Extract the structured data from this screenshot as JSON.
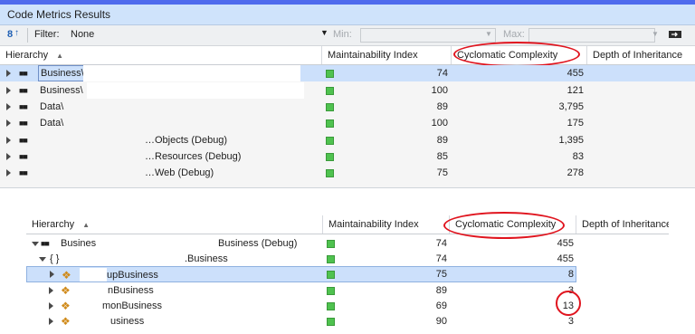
{
  "panel1": {
    "title": "Code Metrics Results",
    "toolbar": {
      "filter_label": "Filter:",
      "filter_value": "None",
      "min_label": "Min:",
      "max_label": "Max:"
    },
    "columns": [
      "Hierarchy",
      "Maintainability Index",
      "Cyclomatic Complexity",
      "Depth of Inheritance"
    ],
    "rows": [
      {
        "name": "Business\\",
        "mi": "74",
        "cc": "455"
      },
      {
        "name": "Business\\",
        "mi": "100",
        "cc": "121"
      },
      {
        "name": "Data\\",
        "mi": "89",
        "cc": "3,795"
      },
      {
        "name": "Data\\",
        "mi": "100",
        "cc": "175"
      },
      {
        "name": "…Objects (Debug)",
        "mi": "89",
        "cc": "1,395"
      },
      {
        "name": "…Resources (Debug)",
        "mi": "85",
        "cc": "83"
      },
      {
        "name": "…Web (Debug)",
        "mi": "75",
        "cc": "278"
      }
    ]
  },
  "panel2": {
    "columns": [
      "Hierarchy",
      "Maintainability Index",
      "Cyclomatic Complexity",
      "Depth of Inheritance"
    ],
    "rows": [
      {
        "name_a": "Busines",
        "name_b": "Business (Debug)",
        "mi": "74",
        "cc": "455"
      },
      {
        "name_a": "{ }",
        "name_b": ".Business",
        "mi": "74",
        "cc": "455"
      },
      {
        "name_b": "upBusiness",
        "mi": "75",
        "cc": "8"
      },
      {
        "name_b": "nBusiness",
        "mi": "89",
        "cc": "3"
      },
      {
        "name_b": "monBusiness",
        "mi": "69",
        "cc": "13"
      },
      {
        "name_b": "usiness",
        "mi": "90",
        "cc": "3"
      }
    ]
  },
  "colors": {
    "highlight": "#e0141e",
    "selection": "#cce0fb",
    "index_green": "#4fc24f"
  },
  "icons": [
    "metrics-icon",
    "expand-arrow-icon",
    "assembly-icon",
    "namespace-icon",
    "class-icon",
    "sort-up-icon",
    "apply-filter-icon"
  ]
}
